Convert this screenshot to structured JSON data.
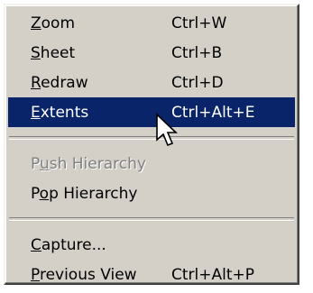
{
  "menu": {
    "sections": [
      [
        {
          "id": "zoom",
          "pre": "",
          "ul": "Z",
          "post": "oom",
          "shortcut": "Ctrl+W",
          "enabled": true,
          "highlighted": false
        },
        {
          "id": "sheet",
          "pre": "",
          "ul": "S",
          "post": "heet",
          "shortcut": "Ctrl+B",
          "enabled": true,
          "highlighted": false
        },
        {
          "id": "redraw",
          "pre": "",
          "ul": "R",
          "post": "edraw",
          "shortcut": "Ctrl+D",
          "enabled": true,
          "highlighted": false
        },
        {
          "id": "extents",
          "pre": "",
          "ul": "E",
          "post": "xtents",
          "shortcut": "Ctrl+Alt+E",
          "enabled": true,
          "highlighted": true
        }
      ],
      [
        {
          "id": "push-hierarchy",
          "pre": "P",
          "ul": "u",
          "post": "sh Hierarchy",
          "shortcut": "",
          "enabled": false,
          "highlighted": false
        },
        {
          "id": "pop-hierarchy",
          "pre": "P",
          "ul": "o",
          "post": "p Hierarchy",
          "shortcut": "",
          "enabled": true,
          "highlighted": false
        }
      ],
      [
        {
          "id": "capture",
          "pre": "",
          "ul": "C",
          "post": "apture...",
          "shortcut": "",
          "enabled": true,
          "highlighted": false
        },
        {
          "id": "previous-view",
          "pre": "",
          "ul": "P",
          "post": "revious View",
          "shortcut": "Ctrl+Alt+P",
          "enabled": true,
          "highlighted": false
        }
      ]
    ]
  },
  "cursor": {
    "icon": "arrow-pointer-icon"
  },
  "colors": {
    "menu_bg": "#d4d0c8",
    "highlight_bg": "#0a246a",
    "highlight_text": "#ffffff",
    "disabled_text": "#808080"
  }
}
